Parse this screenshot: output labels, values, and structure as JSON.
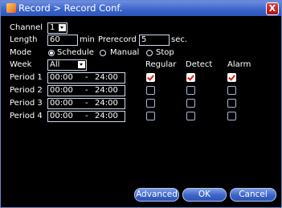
{
  "window": {
    "title": "Record > Record Conf.",
    "close_symbol": "X"
  },
  "channel": {
    "label": "Channel",
    "value": "1"
  },
  "length": {
    "label": "Length",
    "value": "60",
    "unit": "min"
  },
  "prerecord": {
    "label": "Prerecord",
    "value": "5",
    "unit": "sec."
  },
  "mode": {
    "label": "Mode",
    "options": [
      "Schedule",
      "Manual",
      "Stop"
    ],
    "selected": "Schedule"
  },
  "week": {
    "label": "Week",
    "value": "All"
  },
  "columns": {
    "regular": "Regular",
    "detect": "Detect",
    "alarm": "Alarm"
  },
  "periods": [
    {
      "label": "Period 1",
      "start": "00:00",
      "sep": "-",
      "end": "24:00",
      "regular": true,
      "detect": true,
      "alarm": true
    },
    {
      "label": "Period 2",
      "start": "00:00",
      "sep": "-",
      "end": "24:00",
      "regular": false,
      "detect": false,
      "alarm": false
    },
    {
      "label": "Period 3",
      "start": "00:00",
      "sep": "-",
      "end": "24:00",
      "regular": false,
      "detect": false,
      "alarm": false
    },
    {
      "label": "Period 4",
      "start": "00:00",
      "sep": "-",
      "end": "24:00",
      "regular": false,
      "detect": false,
      "alarm": false
    }
  ],
  "buttons": {
    "advanced": "Advanced",
    "ok": "OK",
    "cancel": "Cancel"
  },
  "colors": {
    "title_bar": "#3a62c8",
    "background": "#000000",
    "check_mark": "#dd2211"
  }
}
